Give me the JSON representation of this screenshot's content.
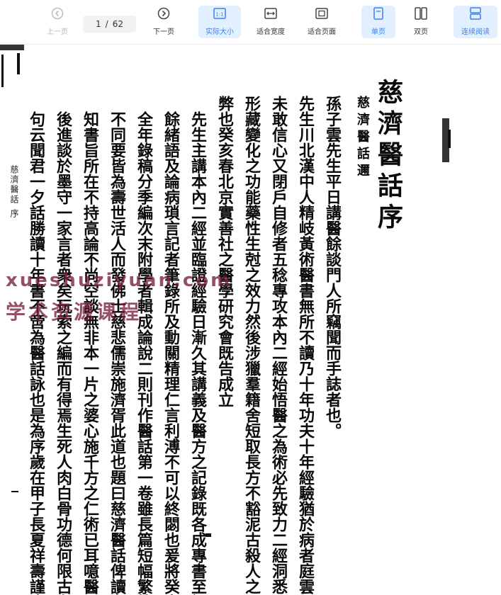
{
  "toolbar": {
    "prev_label": "上一页",
    "page_current": "1",
    "page_separator": "/",
    "page_total": "62",
    "next_label": "下一页",
    "actual_size_label": "实际大小",
    "fit_width_label": "适合宽度",
    "fit_page_label": "适合页面",
    "single_page_label": "单页",
    "double_page_label": "双页",
    "continuous_label": "连续阅读",
    "accent_color": "#3d7ff0",
    "active_bg": "#e2efff"
  },
  "document": {
    "title": "慈濟醫話序",
    "subtitle": "慈濟醫話邇",
    "columns": [
      "孫子雲先生平日講醫餘談門人所竊聞而手誌者也。",
      "先生川北漢中人精岐黃術醫書無所不讀乃十年功夫十年經驗猶於病者庭雲。",
      "未敢信心又閉戶自修者五稔專攻本內二經始悟醫之為術必先致力二經洞悉。",
      "形藏變化之功能藥性生尅之效力然後涉獵羣籍舍短取長方不豁泥古殺人之。",
      "弊也癸亥春北京實善社之醫學研究會既告成立",
      "先生主講本內二經並臨證經驗日漸久其講義及醫方之記錄既各成專書至課",
      "餘緒語及論病瑣言記者筆錄所及動關精理仁言利溥不可以終閟也爰將癸亥",
      "全年錄稿分季編次末附學者輯成論說二則刊作醫話第一卷雖長篇短幅繁簡",
      "不同要皆為壽世活人而發佛士慈悲儒崇施濟胥此道也題曰慈濟醫話俾讀者",
      "知書旨所在不持高論不尚空談無非本一片之婆心施千方之仁術已耳噫醫界",
      "後進談於墨守一家言者衆矣玩索之編而有得焉生死人肉白骨功德何限古有",
      "句云聞君一夕話勝讀十年書不啻為醫話詠也是為序歲在甲子長夏祥壽謹序"
    ],
    "margin_label": "慈濟醫話 序",
    "watermark_line1": "xueshuziyuan.com",
    "watermark_line2": "学术资源课程"
  }
}
